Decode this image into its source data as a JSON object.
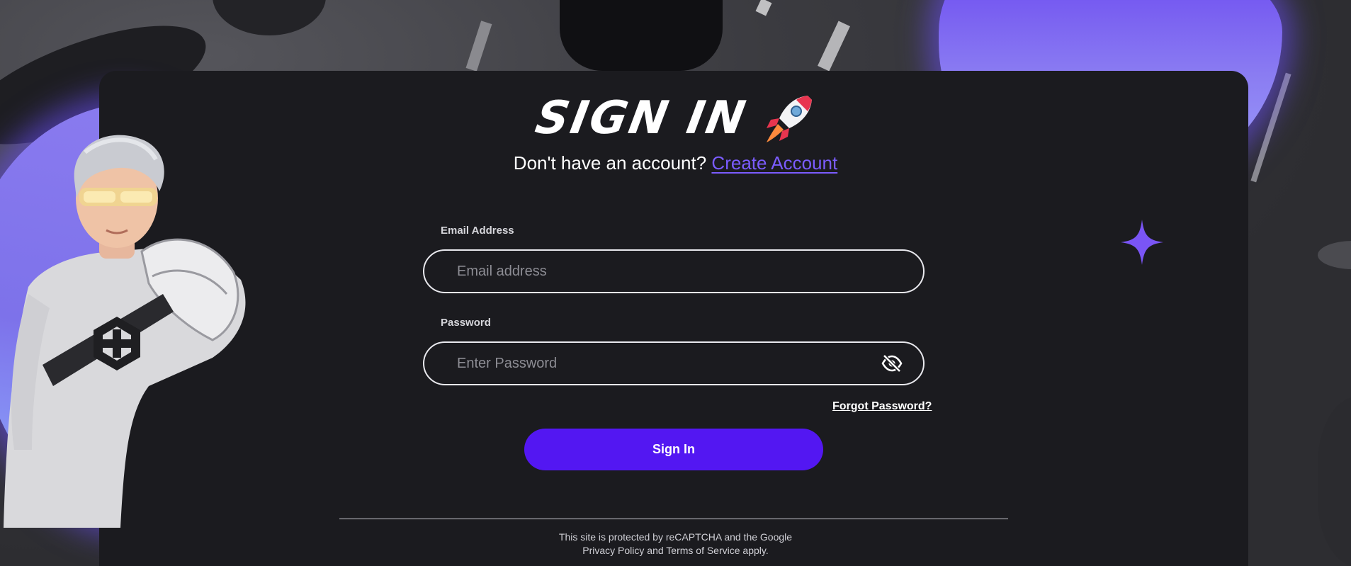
{
  "page": {
    "title": "SIGN IN",
    "subtitle_prefix": "Don't have an account?",
    "create_account_link": "Create Account"
  },
  "form": {
    "email_label": "Email Address",
    "email_placeholder": "Email address",
    "email_value": "",
    "password_label": "Password",
    "password_placeholder": "Enter Password",
    "password_value": "",
    "password_toggle_icon": "eye-slash-icon",
    "forgot_password_link": "Forgot Password?",
    "submit_label": "Sign In"
  },
  "footer": {
    "recaptcha_line": "This site is protected by reCAPTCHA and the Google",
    "privacy_policy": "Privacy Policy",
    "and": "and",
    "terms_of_service": "Terms of Service",
    "apply": "apply."
  },
  "icons": {
    "title_emoji": "rocket-icon",
    "decoration": "sparkle-icon"
  },
  "colors": {
    "accent": "#5317f2",
    "link": "#7b5cff",
    "card_background": "#1b1b1f",
    "blob": "#8a7cf2"
  }
}
